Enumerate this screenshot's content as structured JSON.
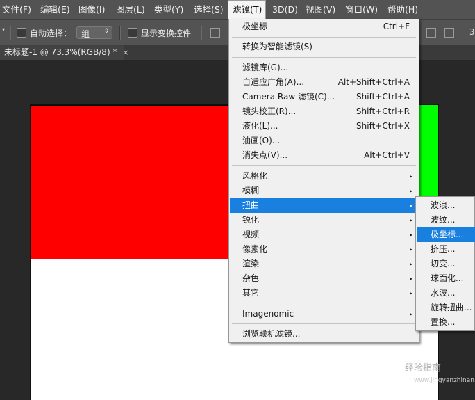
{
  "menubar": {
    "items": [
      "文件(F)",
      "编辑(E)",
      "图像(I)",
      "图层(L)",
      "类型(Y)",
      "选择(S)",
      "滤镜(T)",
      "3D(D)",
      "视图(V)",
      "窗口(W)",
      "帮助(H)"
    ]
  },
  "options": {
    "auto_select_label": "自动选择：",
    "group_value": "组",
    "show_transform_label": "显示变换控件"
  },
  "document": {
    "tab_title": "未标题-1 @ 73.3%(RGB/8) *",
    "close": "×"
  },
  "filter_menu": {
    "items": [
      {
        "label": "极坐标",
        "shortcut": "Ctrl+F"
      },
      {
        "label": "转换为智能滤镜(S)",
        "shortcut": ""
      },
      {
        "label": "滤镜库(G)...",
        "shortcut": ""
      },
      {
        "label": "自适应广角(A)...",
        "shortcut": "Alt+Shift+Ctrl+A"
      },
      {
        "label": "Camera Raw 滤镜(C)...",
        "shortcut": "Shift+Ctrl+A"
      },
      {
        "label": "镜头校正(R)...",
        "shortcut": "Shift+Ctrl+R"
      },
      {
        "label": "液化(L)...",
        "shortcut": "Shift+Ctrl+X"
      },
      {
        "label": "油画(O)...",
        "shortcut": ""
      },
      {
        "label": "消失点(V)...",
        "shortcut": "Alt+Ctrl+V"
      },
      {
        "label": "风格化",
        "shortcut": ""
      },
      {
        "label": "模糊",
        "shortcut": ""
      },
      {
        "label": "扭曲",
        "shortcut": ""
      },
      {
        "label": "锐化",
        "shortcut": ""
      },
      {
        "label": "视频",
        "shortcut": ""
      },
      {
        "label": "像素化",
        "shortcut": ""
      },
      {
        "label": "渲染",
        "shortcut": ""
      },
      {
        "label": "杂色",
        "shortcut": ""
      },
      {
        "label": "其它",
        "shortcut": ""
      },
      {
        "label": "Imagenomic",
        "shortcut": ""
      },
      {
        "label": "浏览联机滤镜...",
        "shortcut": ""
      }
    ]
  },
  "distort_submenu": {
    "items": [
      "波浪...",
      "波纹...",
      "极坐标...",
      "挤压...",
      "切变...",
      "球面化...",
      "水波...",
      "旋转扭曲...",
      "置换..."
    ]
  },
  "icons": {
    "submenu_arrow": "▸",
    "dropdown_arrow": "◆"
  },
  "watermark": {
    "text": "经验指南",
    "url": "www.jingyanzhinan.com"
  },
  "colors": {
    "highlight": "#1a80e0",
    "red_layer": "#ff0000",
    "green_layer": "#00ff00"
  }
}
